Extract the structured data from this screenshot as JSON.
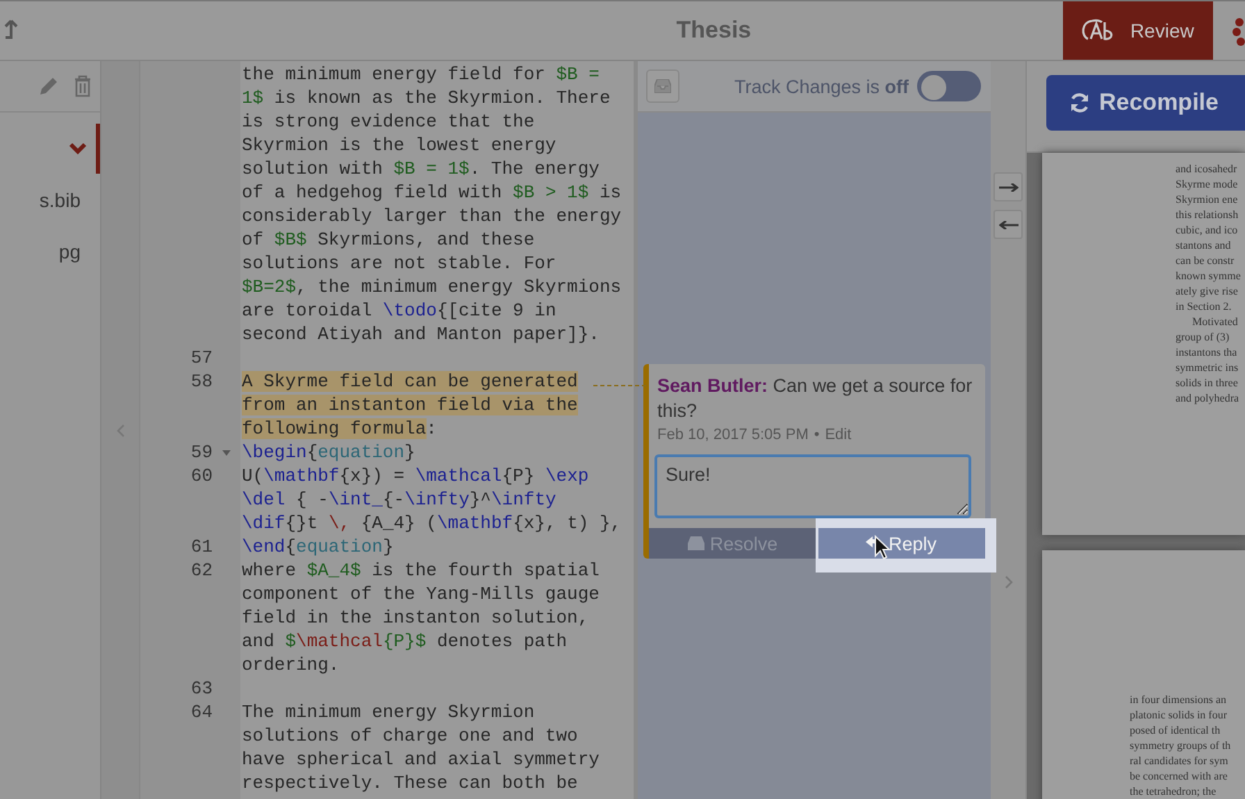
{
  "header": {
    "title": "Thesis",
    "review_button": "Review"
  },
  "file_tree": {
    "folder_expanded": true,
    "items": [
      {
        "label": "s.bib"
      },
      {
        "label": "pg"
      }
    ]
  },
  "editor": {
    "lines": [
      {
        "fold": false,
        "wrapped": [
          {
            "segments": [
              {
                "kind": "plain",
                "text": "the minimum energy field for "
              },
              {
                "kind": "math",
                "text": "$B ="
              }
            ]
          },
          {
            "segments": [
              {
                "kind": "math",
                "text": "1$"
              },
              {
                "kind": "plain",
                "text": " is known as the Skyrmion. There"
              }
            ]
          },
          {
            "segments": [
              {
                "kind": "plain",
                "text": "is strong evidence that the"
              }
            ]
          },
          {
            "segments": [
              {
                "kind": "plain",
                "text": "Skyrmion is the lowest energy"
              }
            ]
          },
          {
            "segments": [
              {
                "kind": "plain",
                "text": "solution with "
              },
              {
                "kind": "math",
                "text": "$B = 1$"
              },
              {
                "kind": "plain",
                "text": ". The energy"
              }
            ]
          },
          {
            "segments": [
              {
                "kind": "plain",
                "text": "of a hedgehog field with "
              },
              {
                "kind": "math",
                "text": "$B > 1$"
              },
              {
                "kind": "plain",
                "text": " is"
              }
            ]
          },
          {
            "segments": [
              {
                "kind": "plain",
                "text": "considerably larger than the energy"
              }
            ]
          },
          {
            "segments": [
              {
                "kind": "plain",
                "text": "of "
              },
              {
                "kind": "math",
                "text": "$B$"
              },
              {
                "kind": "plain",
                "text": " Skyrmions, and these"
              }
            ]
          },
          {
            "segments": [
              {
                "kind": "plain",
                "text": "solutions are not stable. For"
              }
            ]
          },
          {
            "segments": [
              {
                "kind": "math",
                "text": "$B=2$"
              },
              {
                "kind": "plain",
                "text": ", the minimum energy Skyrmions"
              }
            ]
          },
          {
            "segments": [
              {
                "kind": "plain",
                "text": "are toroidal "
              },
              {
                "kind": "command",
                "text": "\\todo"
              },
              {
                "kind": "plain",
                "text": "{[cite 9 in"
              }
            ]
          },
          {
            "segments": [
              {
                "kind": "plain",
                "text": "second Atiyah and Manton paper]}."
              }
            ]
          }
        ]
      },
      {
        "number": "57",
        "fold": false
      },
      {
        "number": "58",
        "fold": false,
        "wrapped": [
          {
            "segments": [
              {
                "kind": "highlight",
                "text": "A Skyrme field can be generated"
              }
            ]
          },
          {
            "segments": [
              {
                "kind": "highlight",
                "text": "from an instanton field via the"
              }
            ]
          },
          {
            "segments": [
              {
                "kind": "highlight",
                "text": "following formula"
              },
              {
                "kind": "plain",
                "text": ":"
              }
            ]
          }
        ]
      },
      {
        "number": "59",
        "fold": true,
        "wrapped": [
          {
            "segments": [
              {
                "kind": "command",
                "text": "\\begin"
              },
              {
                "kind": "plain",
                "text": "{"
              },
              {
                "kind": "env",
                "text": "equation"
              },
              {
                "kind": "plain",
                "text": "}"
              }
            ]
          }
        ]
      },
      {
        "number": "60",
        "fold": false,
        "wrapped": [
          {
            "segments": [
              {
                "kind": "plain",
                "text": "U("
              },
              {
                "kind": "command",
                "text": "\\mathbf"
              },
              {
                "kind": "plain",
                "text": "{x}) = "
              },
              {
                "kind": "command",
                "text": "\\mathcal"
              },
              {
                "kind": "plain",
                "text": "{P} "
              },
              {
                "kind": "command",
                "text": "\\exp"
              }
            ]
          },
          {
            "segments": [
              {
                "kind": "command",
                "text": "\\del"
              },
              {
                "kind": "plain",
                "text": " { -"
              },
              {
                "kind": "command",
                "text": "\\int_"
              },
              {
                "kind": "plain",
                "text": "{-"
              },
              {
                "kind": "command",
                "text": "\\infty"
              },
              {
                "kind": "plain",
                "text": "}^"
              },
              {
                "kind": "command",
                "text": "\\infty"
              }
            ]
          },
          {
            "segments": [
              {
                "kind": "command",
                "text": "\\dif"
              },
              {
                "kind": "plain",
                "text": "{}t "
              },
              {
                "kind": "special",
                "text": "\\,"
              },
              {
                "kind": "plain",
                "text": " {A_4} ("
              },
              {
                "kind": "command",
                "text": "\\mathbf"
              },
              {
                "kind": "plain",
                "text": "{x}, t) },"
              }
            ]
          }
        ]
      },
      {
        "number": "61",
        "fold": false,
        "wrapped": [
          {
            "segments": [
              {
                "kind": "command",
                "text": "\\end"
              },
              {
                "kind": "plain",
                "text": "{"
              },
              {
                "kind": "env",
                "text": "equation"
              },
              {
                "kind": "plain",
                "text": "}"
              }
            ]
          }
        ]
      },
      {
        "number": "62",
        "fold": false,
        "wrapped": [
          {
            "segments": [
              {
                "kind": "plain",
                "text": "where "
              },
              {
                "kind": "math",
                "text": "$A_4$"
              },
              {
                "kind": "plain",
                "text": " is the fourth spatial"
              }
            ]
          },
          {
            "segments": [
              {
                "kind": "plain",
                "text": "component of the Yang-Mills gauge"
              }
            ]
          },
          {
            "segments": [
              {
                "kind": "plain",
                "text": "field in the instanton solution,"
              }
            ]
          },
          {
            "segments": [
              {
                "kind": "plain",
                "text": "and "
              },
              {
                "kind": "math",
                "text": "$"
              },
              {
                "kind": "special",
                "text": "\\mathcal"
              },
              {
                "kind": "math",
                "text": "{P}$"
              },
              {
                "kind": "plain",
                "text": " denotes path"
              }
            ]
          },
          {
            "segments": [
              {
                "kind": "plain",
                "text": "ordering."
              }
            ]
          }
        ]
      },
      {
        "number": "63",
        "fold": false
      },
      {
        "number": "64",
        "fold": false,
        "wrapped": [
          {
            "segments": [
              {
                "kind": "plain",
                "text": "The minimum energy Skyrmion"
              }
            ]
          },
          {
            "segments": [
              {
                "kind": "plain",
                "text": "solutions of charge one and two"
              }
            ]
          },
          {
            "segments": [
              {
                "kind": "plain",
                "text": "have spherical and axial symmetry"
              }
            ]
          },
          {
            "segments": [
              {
                "kind": "plain",
                "text": "respectively. These can both be"
              }
            ]
          }
        ]
      }
    ]
  },
  "review_panel": {
    "track_changes_label": "Track Changes is **off**",
    "track_changes_on": false,
    "comment": {
      "author": "Sean Butler:",
      "text": "Can we get a source for this?",
      "date": "Feb 10, 2017 5:05 PM",
      "separator": "•",
      "edit": "Edit",
      "reply_value": "Sure!",
      "resolve_button": "Resolve",
      "reply_button": "Reply"
    }
  },
  "pdf": {
    "recompile_button": "Recompile",
    "pages": [
      {
        "lines": [
          "and icosahedr",
          "Skyrme mode",
          "Skyrmion ene",
          "this relationsh",
          "cubic, and ico",
          "stantons and",
          "can be constr",
          "known symme",
          "ately give rise",
          "in Section 2.",
          "Motivated",
          "group of (3)",
          "instantons tha",
          "symmetric ins",
          "solids in three",
          "and polyhedra"
        ]
      },
      {
        "lines": [
          "in four dimensions an",
          "platonic solids in four",
          "posed of identical th",
          "symmetry groups of th",
          "ral candidates for sym",
          "be concerned with are",
          "the tetrahedron; the"
        ]
      }
    ]
  }
}
